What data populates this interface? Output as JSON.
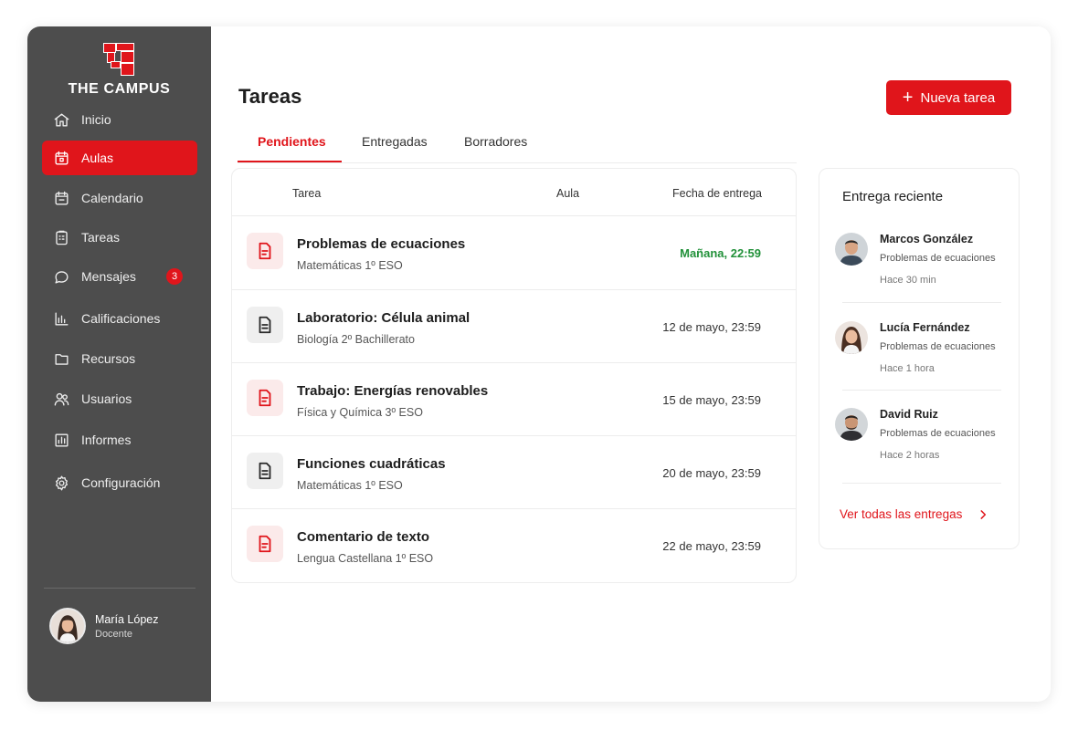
{
  "brand": {
    "name": "THE CAMPUS",
    "accent": "#e0151b",
    "sidebar_bg": "#4d4d4d"
  },
  "sidebar": {
    "items": [
      {
        "label": "Inicio",
        "icon": "home-icon",
        "active": false
      },
      {
        "label": "Aulas",
        "icon": "classroom-calendar-icon",
        "active": true
      },
      {
        "label": "Calendario",
        "icon": "calendar-icon",
        "active": false
      },
      {
        "label": "Tareas",
        "icon": "clipboard-icon",
        "active": false
      },
      {
        "label": "Mensajes",
        "icon": "chat-bubble-icon",
        "active": false,
        "badge": "3"
      },
      {
        "label": "Calificaciones",
        "icon": "bar-chart-icon",
        "active": false
      },
      {
        "label": "Recursos",
        "icon": "folder-icon",
        "active": false
      },
      {
        "label": "Usuarios",
        "icon": "users-icon",
        "active": false
      },
      {
        "label": "Informes",
        "icon": "report-chart-icon",
        "active": false
      },
      {
        "label": "Configuración",
        "icon": "gear-icon",
        "active": false
      }
    ],
    "profile": {
      "name": "María López",
      "role": "Docente"
    }
  },
  "header": {
    "title": "Tareas",
    "new_button": "Nueva tarea"
  },
  "tabs": [
    {
      "label": "Pendientes",
      "active": true
    },
    {
      "label": "Entregadas",
      "active": false
    },
    {
      "label": "Borradores",
      "active": false
    }
  ],
  "table": {
    "columns": [
      "Tarea",
      "Aula",
      "Fecha de entrega"
    ],
    "rows": [
      {
        "title": "Problemas de ecuaciones",
        "course": "Matemáticas 1º ESO",
        "due": "Mañana, 22:59",
        "icon": "document-red-icon",
        "due_highlight": "#22913a"
      },
      {
        "title": "Laboratorio: Célula animal",
        "course": "Biología 2º Bachillerato",
        "due": "12 de mayo, 23:59",
        "icon": "document-gray-icon"
      },
      {
        "title": "Trabajo: Energías renovables",
        "course": "Física y Química 3º ESO",
        "due": "15 de mayo, 23:59",
        "icon": "document-red-icon"
      },
      {
        "title": "Funciones cuadráticas",
        "course": "Matemáticas 1º ESO",
        "due": "20 de mayo, 23:59",
        "icon": "document-gray-icon"
      },
      {
        "title": "Comentario de texto",
        "course": "Lengua Castellana 1º ESO",
        "due": "22 de mayo, 23:59",
        "icon": "document-red-icon"
      }
    ]
  },
  "recent": {
    "title": "Entrega reciente",
    "entries": [
      {
        "name": "Marcos González",
        "task": "Problemas de ecuaciones",
        "time": "Hace 30 min"
      },
      {
        "name": "Lucía Fernández",
        "task": "Problemas de ecuaciones",
        "time": "Hace 1 hora"
      },
      {
        "name": "David Ruiz",
        "task": "Problemas de ecuaciones",
        "time": "Hace 2 horas"
      }
    ],
    "see_all": "Ver todas las entregas"
  }
}
